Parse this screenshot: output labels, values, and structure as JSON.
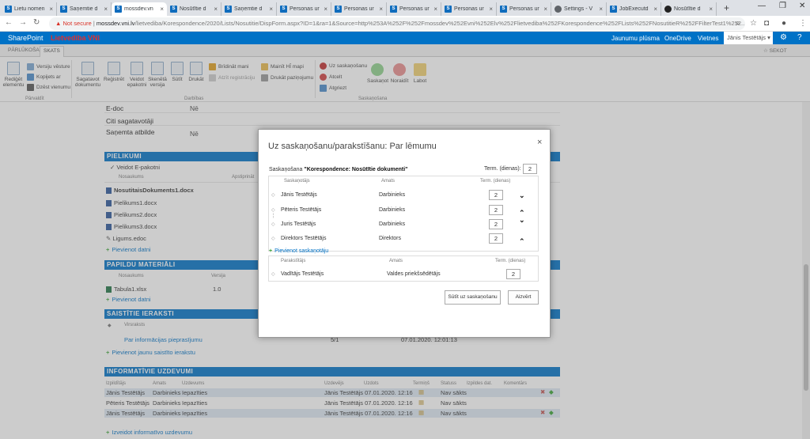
{
  "browser": {
    "tabs": [
      {
        "label": "Lietu nomen"
      },
      {
        "label": "Saņemtie d"
      },
      {
        "label": "mossdev.vn"
      },
      {
        "label": "Nosūtītie d"
      },
      {
        "label": "Saņemtie d"
      },
      {
        "label": "Personas ur"
      },
      {
        "label": "Personas ur"
      },
      {
        "label": "Personas ur"
      },
      {
        "label": "Personas ur"
      },
      {
        "label": "Personas ur"
      },
      {
        "label": "Settings - V"
      },
      {
        "label": "JobExecutd"
      },
      {
        "label": "Nosūtītie d"
      }
    ],
    "new_tab": "+",
    "not_secure": "Not secure",
    "url_domain": "mossdev.vni.lv",
    "url_path": "/lietvediba/Korespondence/2020/Lists/Nosutitie/DispForm.aspx?ID=1&ra=1&Source=http%253A%252F%252Fmossdev%252Evni%252Elv%252Flietvediba%252FKorespondence%252FLists%252FNosutitieR%252FFilterTest1%252..."
  },
  "sharepoint": {
    "brand": "SharePoint",
    "red_label": "Lietvediba VNI",
    "links": [
      "Jaunumu plūsma",
      "OneDrive",
      "Vietnes"
    ],
    "user": "Jānis Testētājs ▾",
    "follow": "SEKOT"
  },
  "ribbon": {
    "tabs": [
      "PĀRLŪKOŠANA",
      "SKATS"
    ],
    "buttons": {
      "edit": "Rediģēt elementu",
      "versions": "Versiju vēsture",
      "copies": "Kopijets ar",
      "delete": "Dzēst vienumu",
      "prepare": "Sagatavot dokumentu",
      "register": "Reģistrēt",
      "envelope": "Veidot epakotni",
      "scan": "Skenētā versija",
      "send": "Sūtīt",
      "print": "Drukāt",
      "warn": "Brīdināt mani",
      "show_reg": "Atzīt registrāciju",
      "change": "Mainīt HĪ mapi",
      "print_pay": "Drukāt paziņojumu",
      "approve": "Uz saskaņošanu",
      "revoke": "Atcelt",
      "recall": "Atgriezt",
      "agree": "Saskaņot",
      "reject": "Noraidīt",
      "label": "Labot"
    },
    "groups": [
      "Pārvaldīt",
      "Darbības",
      "Saskaņošana"
    ]
  },
  "page": {
    "fields": [
      {
        "label": "E-doc",
        "value": "Nē"
      },
      {
        "label": "Citi sagatavotāji",
        "value": ""
      },
      {
        "label": "Saņemta atbilde",
        "value": "Nē"
      }
    ],
    "pielikumi": {
      "title": "PIELIKUMI",
      "make_envelope": "Veidot E-pakotni",
      "col_name": "Nosaukums",
      "col_sign": "Apstiprināt",
      "files": [
        "NosutitaisDokuments1.docx",
        "Pielikums1.docx",
        "Pielikums2.docx",
        "Pielikums3.docx",
        "Ligums.edoc"
      ],
      "add": "Pievienot datni"
    },
    "papildu": {
      "title": "PAPILDU MATERIĀLI",
      "col_name": "Nosaukums",
      "col_version": "Versija",
      "file": "Tabula1.xlsx",
      "version": "1.0",
      "add": "Pievienot datni"
    },
    "saistitie": {
      "title": "SAISTĪTIE IERAKSTI",
      "col": "Virsraksts",
      "item": "Par informācijas pieprasījumu",
      "count": "5/1",
      "date": "07.01.2020. 12:01:13",
      "add": "Pievienot jaunu saistīto ierakstu"
    },
    "informativie": {
      "title": "INFORMATĪVIE UZDEVUMI",
      "cols": [
        "Izpildītājs",
        "Amats",
        "Uzdevums",
        "Uzdevējs",
        "Uzdots",
        "Termiņš",
        "Statuss",
        "Izpildes dat.",
        "Komentārs"
      ],
      "rows": [
        {
          "izp": "Jānis Testētājs",
          "amats": "Darbinieks",
          "uzd": "Iepazīties",
          "uzdevejs": "Jānis Testētājs 07.01.2020. 12:16",
          "statuss": "Nav sākts"
        },
        {
          "izp": "Pēteris Testētājs",
          "amats": "Darbinieks",
          "uzd": "Iepazīties",
          "uzdevejs": "Jānis Testētājs 07.01.2020. 12:16",
          "statuss": "Nav sākts"
        },
        {
          "izp": "Jānis Testētājs",
          "amats": "Darbinieks",
          "uzd": "Iepazīties",
          "uzdevejs": "Jānis Testētājs 07.01.2020. 12:16",
          "statuss": "Nav sākts"
        }
      ],
      "add": "Izveidot informatīvo uzdevumu"
    }
  },
  "dialog": {
    "title": "Uz saskaņošanu/parakstīšanu: Par lēmumu",
    "close": "×",
    "sask_prefix": "Saskaņošana ",
    "sask_doc": "\"Korespondence: Nosūtītie dokumenti\"",
    "term_label": "Term. (dienas):",
    "term_value": "2",
    "cols": {
      "person": "Saskaņotājs",
      "role": "Amats",
      "term": "Term. (dienas)"
    },
    "approvers": [
      {
        "name": "Jānis Testētājs",
        "role": "Darbinieks",
        "term": "2"
      },
      {
        "name": "Pēteris Testētājs",
        "role": "Darbinieks",
        "term": "2"
      },
      {
        "name": "Juris Testētājs",
        "role": "Darbinieks",
        "term": "2"
      },
      {
        "name": "Direktors Testētājs",
        "role": "Direktors",
        "term": "2"
      }
    ],
    "add_link": "Pievienot saskaņotāju",
    "signer_cols": {
      "person": "Parakstītājs",
      "role": "Amats",
      "term": "Term. (dienas)"
    },
    "signer": {
      "name": "Vadītājs Testētājs",
      "role": "Valdes priekšsēdētājs",
      "term": "2"
    },
    "send_button": "Sūtīt uz saskaņošanu",
    "close_button": "Aizvērt"
  }
}
